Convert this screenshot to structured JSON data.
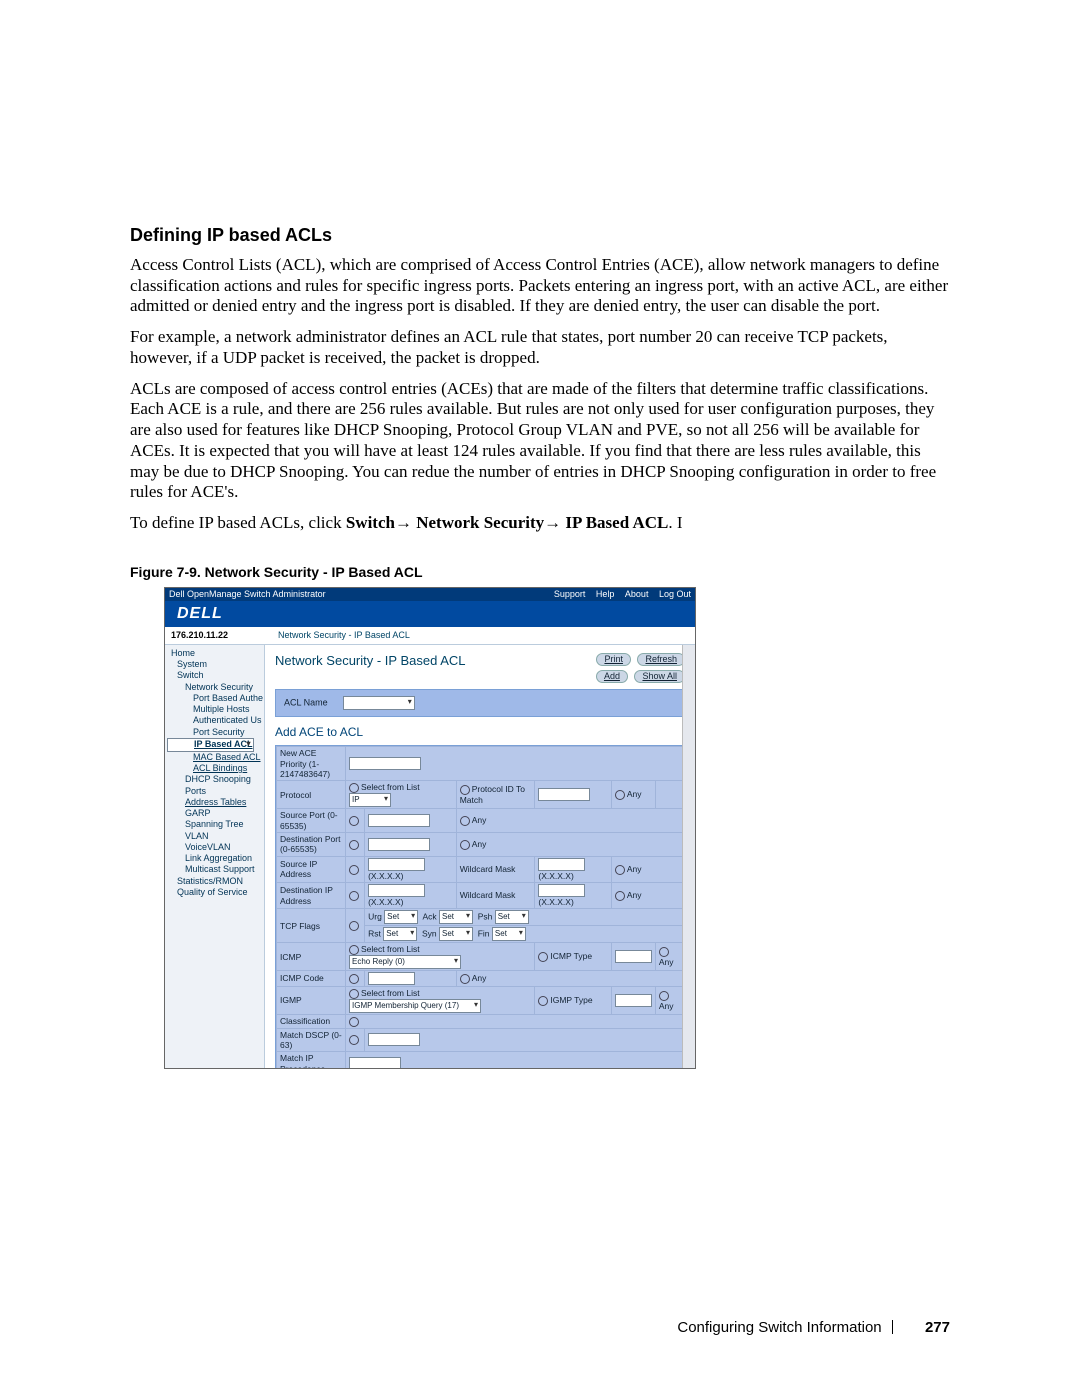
{
  "section_title": "Defining IP based ACLs",
  "paragraphs": {
    "p1": "Access Control Lists (ACL), which are comprised of Access Control Entries (ACE), allow network managers to define classification actions and rules for specific ingress ports. Packets entering an ingress port, with an active ACL, are either admitted or denied entry and the ingress port is disabled. If they are denied entry, the user can disable the port.",
    "p2": "For example, a network administrator defines an ACL rule that states, port number 20 can receive TCP packets, however, if a UDP packet is received, the packet is dropped.",
    "p3": "ACLs are composed of access control entries (ACEs) that are made of the filters that determine traffic classifications. Each ACE is a rule, and there are 256 rules available. But rules are not only used for user configuration purposes, they are also used for features like DHCP Snooping, Protocol Group VLAN and PVE, so not all 256 will be available for ACEs. It is expected that you will have at least 124 rules available. If you find that there are less rules available, this may be due to DHCP Snooping. You can redue the number of entries in DHCP Snooping configuration in order to free rules for ACE's.",
    "nav_prefix": "To define IP based ACLs, click ",
    "nav_bold": "Switch→ Network Security→ IP Based ACL",
    "nav_suffix": ". I"
  },
  "figure_caption": "Figure 7-9.    Network Security - IP Based ACL",
  "app": {
    "window_title": "Dell OpenManage Switch Administrator",
    "top_links": [
      "Support",
      "Help",
      "About",
      "Log Out"
    ],
    "logo": "DELL",
    "ip": "176.210.11.22",
    "breadcrumb": "Network Security - IP Based ACL",
    "page_title": "Network Security - IP Based ACL",
    "buttons": {
      "print": "Print",
      "refresh": "Refresh",
      "add": "Add",
      "showall": "Show All"
    },
    "tree": [
      {
        "t": "Home"
      },
      {
        "t": "System",
        "cls": "l1"
      },
      {
        "t": "Switch",
        "cls": "l1"
      },
      {
        "t": "Network Security",
        "cls": "l2"
      },
      {
        "t": "Port Based Authe",
        "cls": "l3"
      },
      {
        "t": "Multiple Hosts",
        "cls": "l3"
      },
      {
        "t": "Authenticated Us",
        "cls": "l3"
      },
      {
        "t": "Port Security",
        "cls": "l3"
      },
      {
        "t": "IP Based ACL",
        "cls": "l3 sel"
      },
      {
        "t": "MAC Based ACL",
        "cls": "l3 u"
      },
      {
        "t": "ACL Bindings",
        "cls": "l3 u"
      },
      {
        "t": "DHCP Snooping",
        "cls": "l2"
      },
      {
        "t": "Ports",
        "cls": "l2"
      },
      {
        "t": "Address Tables",
        "cls": "l2 u"
      },
      {
        "t": "GARP",
        "cls": "l2"
      },
      {
        "t": "Spanning Tree",
        "cls": "l2"
      },
      {
        "t": "VLAN",
        "cls": "l2"
      },
      {
        "t": "VoiceVLAN",
        "cls": "l2"
      },
      {
        "t": "Link Aggregation",
        "cls": "l2"
      },
      {
        "t": "Multicast Support",
        "cls": "l2"
      },
      {
        "t": "Statistics/RMON",
        "cls": "l1"
      },
      {
        "t": "Quality of Service",
        "cls": "l1"
      }
    ],
    "form": {
      "acl_name_label": "ACL Name",
      "add_ace_header": "Add ACE to ACL",
      "rows": {
        "new_ace": "New ACE Priority (1-2147483647)",
        "protocol": "Protocol",
        "select_list": "Select from List",
        "ip": "IP",
        "proto_id": "Protocol ID To Match",
        "any": "Any",
        "src_port": "Source Port (0-65535)",
        "dst_port": "Destination Port (0-65535)",
        "src_ip": "Source IP Address",
        "dst_ip": "Destination IP Address",
        "xxxx": "(X.X.X.X)",
        "wmask": "Wildcard Mask",
        "tcp": "TCP Flags",
        "urg": "Urg",
        "ack": "Ack",
        "psh": "Psh",
        "rst": "Rst",
        "syn": "Syn",
        "fin": "Fin",
        "set": "Set",
        "icmp": "ICMP",
        "icmp_code": "ICMP Code",
        "icmp_type": "ICMP Type",
        "echo": "Echo Reply (0)",
        "igmp": "IGMP",
        "igmp_type": "IGMP Type",
        "igmp_q": "IGMP Membership Query (17)",
        "class": "Classification",
        "dscp": "Match DSCP (0-63)",
        "ipprec": "Match IP Precedence"
      }
    }
  },
  "footer": {
    "chapter": "Configuring Switch Information",
    "page": "277"
  }
}
